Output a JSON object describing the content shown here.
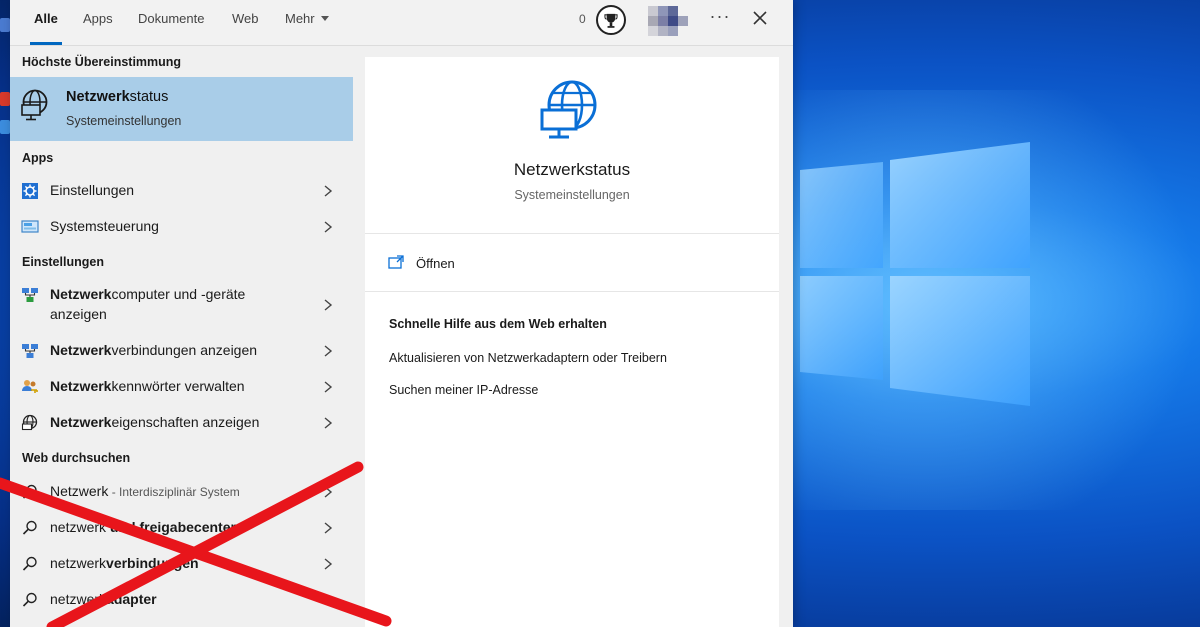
{
  "tabs": [
    {
      "label": "Alle",
      "active": true
    },
    {
      "label": "Apps"
    },
    {
      "label": "Dokumente"
    },
    {
      "label": "Web"
    },
    {
      "label": "Mehr"
    }
  ],
  "header": {
    "score": "0",
    "more_icon": "ellipsis-icon",
    "close_icon": "close-icon"
  },
  "sections": {
    "best_match": "Höchste Übereinstimmung",
    "apps": "Apps",
    "settings": "Einstellungen",
    "web": "Web durchsuchen"
  },
  "best": {
    "title_bold": "Netzwerk",
    "title_rest": "status",
    "subtitle": "Systemeinstellungen",
    "icon": "globe-monitor-icon"
  },
  "apps": [
    {
      "label": "Einstellungen",
      "icon": "gear-icon"
    },
    {
      "label": "Systemsteuerung",
      "icon": "control-panel-icon"
    }
  ],
  "settings": [
    {
      "bold": "Netzwerk",
      "rest": "computer und -geräte",
      "line2": "anzeigen",
      "icon": "network-computers-icon"
    },
    {
      "bold": "Netzwerk",
      "rest": "verbindungen anzeigen",
      "icon": "network-connections-icon"
    },
    {
      "bold": "Netzwerk",
      "rest": "kennwörter verwalten",
      "icon": "users-key-icon"
    },
    {
      "bold": "Netzwerk",
      "rest": "eigenschaften anzeigen",
      "icon": "globe-icon"
    }
  ],
  "web": [
    {
      "label": "Netzwerk",
      "sub": " - Interdisziplinär System",
      "icon": "search-icon"
    },
    {
      "plain": "netzwerk ",
      "bold": "und freigabecenter",
      "icon": "search-icon"
    },
    {
      "plain": "netzwerk",
      "bold": "verbindungen",
      "icon": "search-icon"
    },
    {
      "plain": "netzwerk",
      "bold": "adapter",
      "icon": "search-icon"
    }
  ],
  "detail": {
    "title": "Netzwerkstatus",
    "subtitle": "Systemeinstellungen",
    "open_label": "Öffnen",
    "help_heading": "Schnelle Hilfe aus dem Web erhalten",
    "help_links": [
      "Aktualisieren von Netzwerkadaptern oder Treibern",
      "Suchen meiner IP-Adresse"
    ]
  },
  "colors": {
    "accent": "#0067c0",
    "selected": "#a9cde8",
    "cross": "#e8151b",
    "desktop": "#0b52c4"
  }
}
